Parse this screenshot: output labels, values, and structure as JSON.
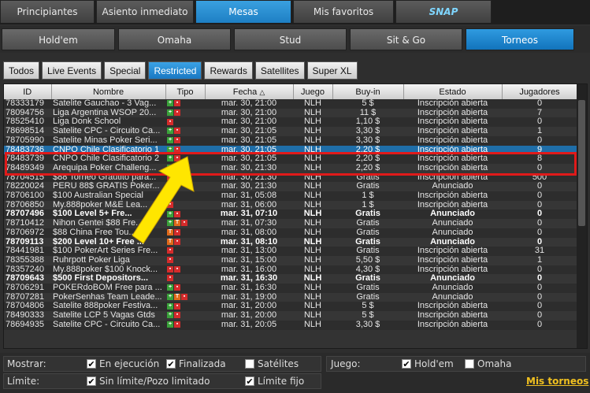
{
  "top_tabs": [
    "Principiantes",
    "Asiento inmediato",
    "Mesas",
    "Mis favoritos",
    "SNAP"
  ],
  "game_tabs": [
    "Hold'em",
    "Omaha",
    "Stud",
    "Sit & Go",
    "Torneos"
  ],
  "filter_tabs": [
    "Todos",
    "Live Events",
    "Special",
    "Restricted",
    "Rewards",
    "Satellites",
    "Super XL"
  ],
  "columns": [
    "ID",
    "Nombre",
    "Tipo",
    "Fecha",
    "Juego",
    "Buy-in",
    "Estado",
    "Jugadores"
  ],
  "rows": [
    [
      "78333179",
      "Satelite Gauchao - 3 Vag...",
      "gr",
      "mar. 30, 21:00",
      "NLH",
      "5 $",
      "Inscripción abierta",
      "0"
    ],
    [
      "78094756",
      "Liga Argentina WSOP 20...",
      "gr",
      "mar. 30, 21:00",
      "NLH",
      "11 $",
      "Inscripción abierta",
      "7"
    ],
    [
      "78525410",
      "Liga Donk School",
      "r",
      "mar. 30, 21:00",
      "NLH",
      "1,10 $",
      "Inscripción abierta",
      "0"
    ],
    [
      "78698514",
      "Satelite CPC - Circuito Ca...",
      "gr",
      "mar. 30, 21:05",
      "NLH",
      "3,30 $",
      "Inscripción abierta",
      "1"
    ],
    [
      "78705990",
      "Satelite Minas Poker Seri...",
      "gr",
      "mar. 30, 21:05",
      "NLH",
      "3,30 $",
      "Inscripción abierta",
      "0"
    ],
    [
      "78483736",
      "CNPO Chile Clasificatorio 1",
      "gr",
      "mar. 30, 21:05",
      "NLH",
      "2,20 $",
      "Inscripción abierta",
      "9"
    ],
    [
      "78483739",
      "CNPO Chile Clasificatorio 2",
      "gr",
      "mar. 30, 21:05",
      "NLH",
      "2,20 $",
      "Inscripción abierta",
      "8"
    ],
    [
      "78489349",
      "Arequipa Poker Challeng...",
      "gr",
      "mar. 30, 21:30",
      "NLH",
      "2,20 $",
      "Inscripción abierta",
      "0"
    ],
    [
      "78704515",
      "$88 Torneo Grautito para...",
      "r",
      "mar. 30, 21:30",
      "NLH",
      "Gratis",
      "Inscripción abierta",
      "500"
    ],
    [
      "78220024",
      "PERU 88$ GRATIS Poker...",
      "r",
      "mar. 30, 21:30",
      "NLH",
      "Gratis",
      "Anunciado",
      "0"
    ],
    [
      "78706100",
      "$100 Australian Special",
      "r",
      "mar. 31, 05:08",
      "NLH",
      "1 $",
      "Inscripción abierta",
      "0"
    ],
    [
      "78706850",
      "My.888poker M&E Lea...",
      "r",
      "mar. 31, 06:00",
      "NLH",
      "1 $",
      "Inscripción abierta",
      "0"
    ],
    [
      "78707496",
      "$100 Level 5+ Fre...",
      "gr",
      "mar. 31, 07:10",
      "NLH",
      "Gratis",
      "Anunciado",
      "0"
    ],
    [
      "78710412",
      "Nihon Gentei $88 Fre...",
      "gor",
      "mar. 31, 07:30",
      "NLH",
      "Gratis",
      "Anunciado",
      "0"
    ],
    [
      "78706972",
      "$88 China Free Tou...",
      "or",
      "mar. 31, 08:00",
      "NLH",
      "Gratis",
      "Anunciado",
      "0"
    ],
    [
      "78709113",
      "$200 Level 10+ Free ...",
      "or",
      "mar. 31, 08:10",
      "NLH",
      "Gratis",
      "Anunciado",
      "0"
    ],
    [
      "78441981",
      "$100 PokerArt Series Fre...",
      "r",
      "mar. 31, 13:00",
      "NLH",
      "Gratis",
      "Inscripción abierta",
      "31"
    ],
    [
      "78355388",
      "Ruhrpott Poker Liga",
      "r",
      "mar. 31, 15:00",
      "NLH",
      "5,50 $",
      "Inscripción abierta",
      "1"
    ],
    [
      "78357240",
      "My.888poker $100 Knock...",
      "rr",
      "mar. 31, 16:00",
      "NLH",
      "4,30 $",
      "Inscripción abierta",
      "0"
    ],
    [
      "78709643",
      "$500 First Depositors...",
      "r",
      "mar. 31, 16:30",
      "NLH",
      "Gratis",
      "Anunciado",
      "0"
    ],
    [
      "78706291",
      "POKERdoBOM Free para ...",
      "gr",
      "mar. 31, 16:30",
      "NLH",
      "Gratis",
      "Anunciado",
      "0"
    ],
    [
      "78707281",
      "PokerSenhas Team Leade...",
      "gor",
      "mar. 31, 19:00",
      "NLH",
      "Gratis",
      "Anunciado",
      "0"
    ],
    [
      "78704806",
      "Satelite 888poker Festiva...",
      "gr",
      "mar. 31, 20:00",
      "NLH",
      "5 $",
      "Inscripción abierta",
      "0"
    ],
    [
      "78490333",
      "Satelite LCP 5 Vagas Gtds",
      "gr",
      "mar. 31, 20:00",
      "NLH",
      "5 $",
      "Inscripción abierta",
      "0"
    ],
    [
      "78694935",
      "Satelite CPC - Circuito Ca...",
      "gr",
      "mar. 31, 20:05",
      "NLH",
      "3,30 $",
      "Inscripción abierta",
      "0"
    ]
  ],
  "bold_rows": [
    12,
    15,
    19
  ],
  "selected_row": 5,
  "bottom": {
    "mostrar": "Mostrar:",
    "en_ejecucion": "En ejecución",
    "finalizada": "Finalizada",
    "satelites": "Satélites",
    "juego": "Juego:",
    "holdem": "Hold'em",
    "omaha": "Omaha",
    "limite": "Límite:",
    "sin_limite": "Sin límite/Pozo limitado",
    "limite_fijo": "Límite fijo",
    "mis_torneos": "Mis torneos"
  }
}
